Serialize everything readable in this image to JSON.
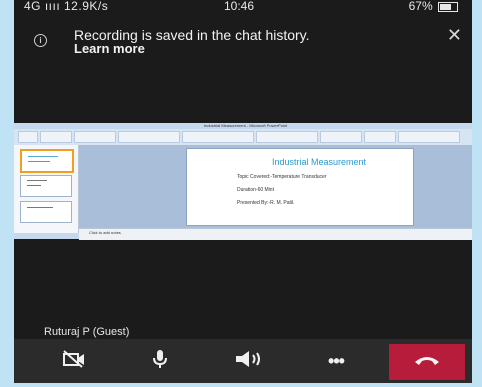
{
  "status_bar": {
    "left": "4G ıııı 12.9K/s",
    "time": "10:46",
    "right": "67%"
  },
  "banner": {
    "message": "Recording is saved in the chat history.",
    "link": "Learn more"
  },
  "shared_screen": {
    "app_title": "Industrial Measurement - Microsoft PowerPoint",
    "slide_title": "Industrial Measurement",
    "slide_lines": [
      "Topic Covered:-Temperature Transducer",
      "Duration-60 Mint",
      "Presented By:-R. M. Patil."
    ],
    "notes_placeholder": "Click to add notes"
  },
  "participant": {
    "name": "Ruturaj P (Guest)"
  },
  "call_controls": {
    "camera_icon": "camera-off-icon",
    "mic_icon": "microphone-icon",
    "speaker_icon": "speaker-icon",
    "more_icon": "more-options-icon",
    "hangup_icon": "hang-up-icon",
    "hangup_color": "#b71c3a"
  }
}
